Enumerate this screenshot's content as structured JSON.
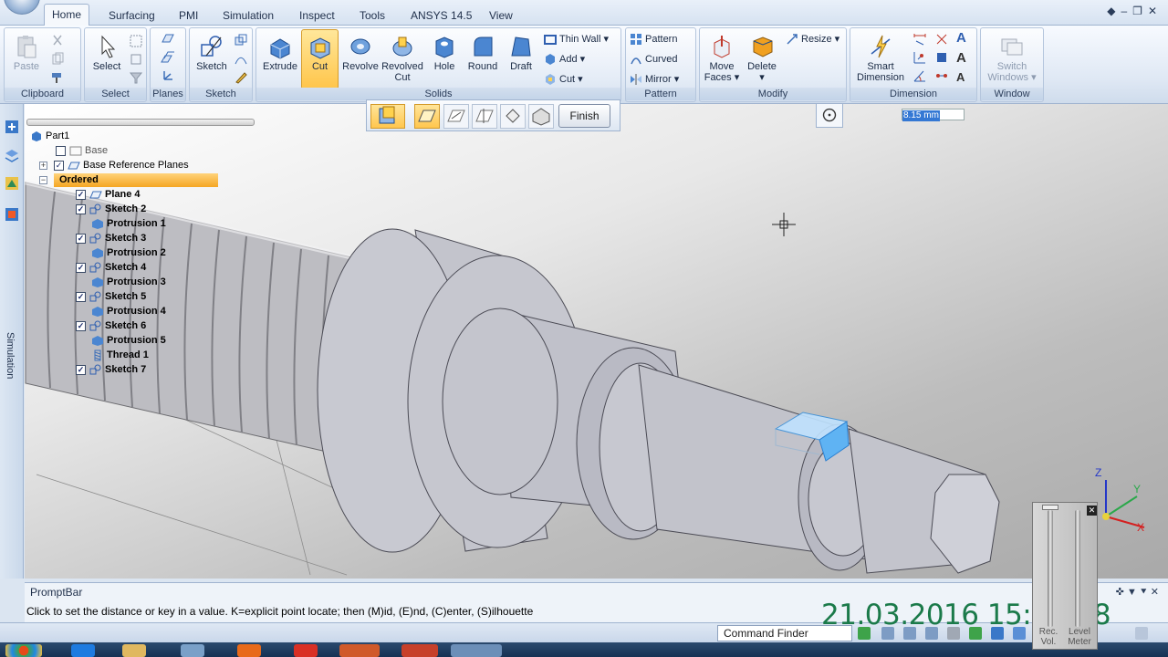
{
  "tabs": [
    "Home",
    "Surfacing",
    "PMI",
    "Simulation",
    "Inspect",
    "Tools",
    "ANSYS 14.5",
    "View"
  ],
  "ribbon": {
    "clipboard": {
      "label": "Clipboard",
      "paste": "Paste"
    },
    "select": {
      "label": "Select",
      "select": "Select"
    },
    "planes": {
      "label": "Planes"
    },
    "sketch": {
      "label": "Sketch",
      "sketch": "Sketch"
    },
    "solids": {
      "label": "Solids",
      "extrude": "Extrude",
      "cut": "Cut",
      "revolve": "Revolve",
      "revolved_cut_line1": "Revolved",
      "revolved_cut_line2": "Cut",
      "hole": "Hole",
      "round": "Round",
      "draft": "Draft",
      "thin_wall": "Thin Wall",
      "add": "Add",
      "cut_small": "Cut"
    },
    "pattern": {
      "label": "Pattern",
      "pattern": "Pattern",
      "curved": "Curved",
      "mirror": "Mirror"
    },
    "modify": {
      "label": "Modify",
      "move_faces_line1": "Move",
      "move_faces_line2": "Faces",
      "delete": "Delete",
      "resize": "Resize"
    },
    "dimension": {
      "label": "Dimension",
      "smart_line1": "Smart",
      "smart_line2": "Dimension"
    },
    "window": {
      "label": "Window",
      "switch_line1": "Switch",
      "switch_line2": "Windows"
    }
  },
  "tree": {
    "root": "Part1",
    "items": [
      {
        "label": "Base",
        "dim": true
      },
      {
        "label": "Base Reference Planes"
      },
      {
        "label": "Ordered"
      },
      {
        "label": "Plane 4"
      },
      {
        "label": "Sketch 2"
      },
      {
        "label": "Protrusion 1"
      },
      {
        "label": "Sketch 3"
      },
      {
        "label": "Protrusion 2"
      },
      {
        "label": "Sketch 4"
      },
      {
        "label": "Protrusion 3"
      },
      {
        "label": "Sketch 5"
      },
      {
        "label": "Protrusion 4"
      },
      {
        "label": "Sketch 6"
      },
      {
        "label": "Protrusion 5"
      },
      {
        "label": "Thread 1"
      },
      {
        "label": "Sketch 7"
      }
    ]
  },
  "left_strip": {
    "simulation": "Simulation"
  },
  "command_bar": {
    "finish": "Finish"
  },
  "dimension_input": {
    "value": "8.15 mm"
  },
  "prompt": {
    "title": "PromptBar",
    "text": "Click to set the distance or key in a value.  K=explicit point locate; then (M)id, (E)nd, (C)enter, (S)ilhouette"
  },
  "status": {
    "command_finder": "Command Finder"
  },
  "overlay": {
    "timestamp": "21.03.2016 15:43:48",
    "rec_vol_line1": "Rec.",
    "rec_vol_line2": "Vol.",
    "level_meter_line1": "Level",
    "level_meter_line2": "Meter"
  },
  "axes": {
    "x": "X",
    "y": "Y",
    "z": "Z"
  },
  "colors": {
    "accent": "#ffc54a",
    "ordered_highlight": "#f5a623",
    "selection_blue": "#3478d4",
    "timestamp": "#1b7a4a"
  }
}
